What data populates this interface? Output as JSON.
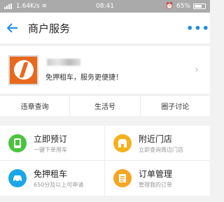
{
  "status_bar": {
    "network": "1.64K/s",
    "time": "08:41",
    "battery": "65%"
  },
  "header": {
    "title": "商户服务",
    "back_icon": "arrow-left-icon",
    "more_icon": "more-dots-icon"
  },
  "merchant": {
    "slogan": "免押租车，服务更便捷！"
  },
  "links": [
    {
      "label": "违章查询"
    },
    {
      "label": "生活号"
    },
    {
      "label": "圈子讨论"
    }
  ],
  "services": [
    {
      "title": "立即预订",
      "subtitle": "一键下单用车",
      "color": "#4cc33f",
      "icon": "phone-icon"
    },
    {
      "title": "附近门店",
      "subtitle": "立即查询周边门店",
      "color": "#f5b120",
      "icon": "store-icon"
    },
    {
      "title": "免押租车",
      "subtitle": "650分及以上可申请",
      "color": "#1aa6e8",
      "icon": "car-icon"
    },
    {
      "title": "订单管理",
      "subtitle": "管理我的订单",
      "color": "#f5a623",
      "icon": "order-icon"
    }
  ]
}
